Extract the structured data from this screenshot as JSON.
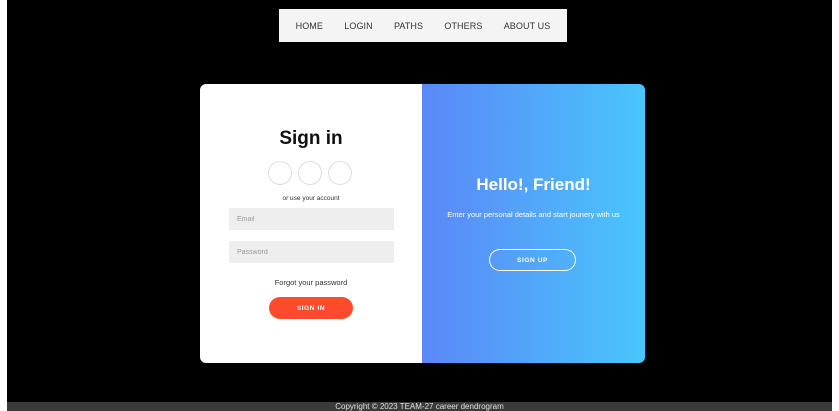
{
  "nav": {
    "items": [
      {
        "label": "HOME"
      },
      {
        "label": "LOGIN"
      },
      {
        "label": "PATHS"
      },
      {
        "label": "OTHERS"
      },
      {
        "label": "ABOUT US"
      }
    ]
  },
  "signin": {
    "title": "Sign in",
    "alt_text": "or use your account",
    "email_placeholder": "Email",
    "password_placeholder": "Password",
    "forgot_label": "Forgot your password",
    "button_label": "SIGN IN"
  },
  "overlay": {
    "title": "Hello!, Friend!",
    "text": "Enter your personal details and start jounery with us",
    "button_label": "SIGN UP"
  },
  "footer": {
    "text": "Copyright © 2023 TEAM-27 career dendrogram"
  },
  "colors": {
    "accent": "#ff4b2b",
    "gradient_start": "#5b87f8",
    "gradient_end": "#49c6fb",
    "page_background": "#000000"
  }
}
